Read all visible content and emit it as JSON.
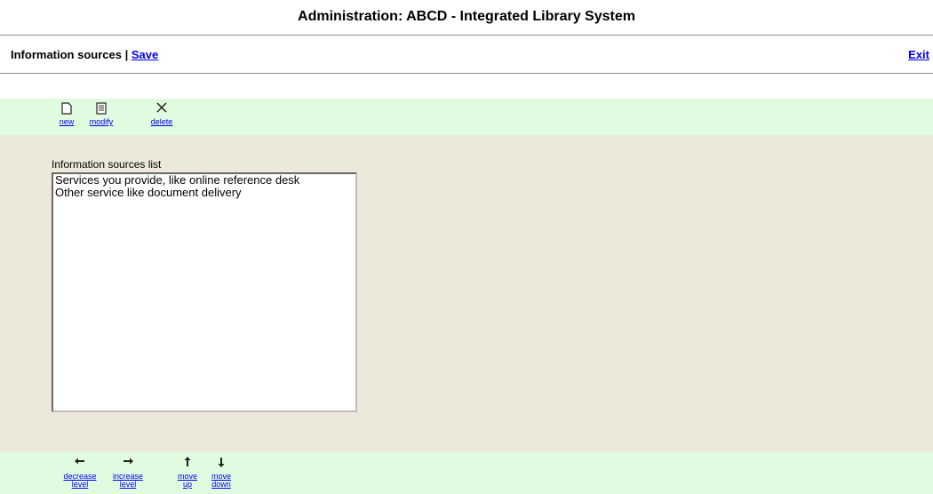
{
  "header": {
    "title": "Administration: ABCD - Integrated Library System"
  },
  "subbar": {
    "section": "Information sources |",
    "save_label": "Save",
    "exit_label": "Exit"
  },
  "toolbar_top": {
    "new_label": "new",
    "modify_label": "modify",
    "delete_label": "delete"
  },
  "list": {
    "label": "Information sources list",
    "options": [
      "Services you provide, like online reference desk",
      "Other service like document delivery"
    ]
  },
  "toolbar_bottom": {
    "decrease_label": "decrease level",
    "increase_label": "increase level",
    "up_label": "move up",
    "down_label": "move down"
  },
  "colors": {
    "toolbar_bg": "#e0fbe0",
    "content_bg": "#ede9da",
    "link": "#0000ee"
  }
}
